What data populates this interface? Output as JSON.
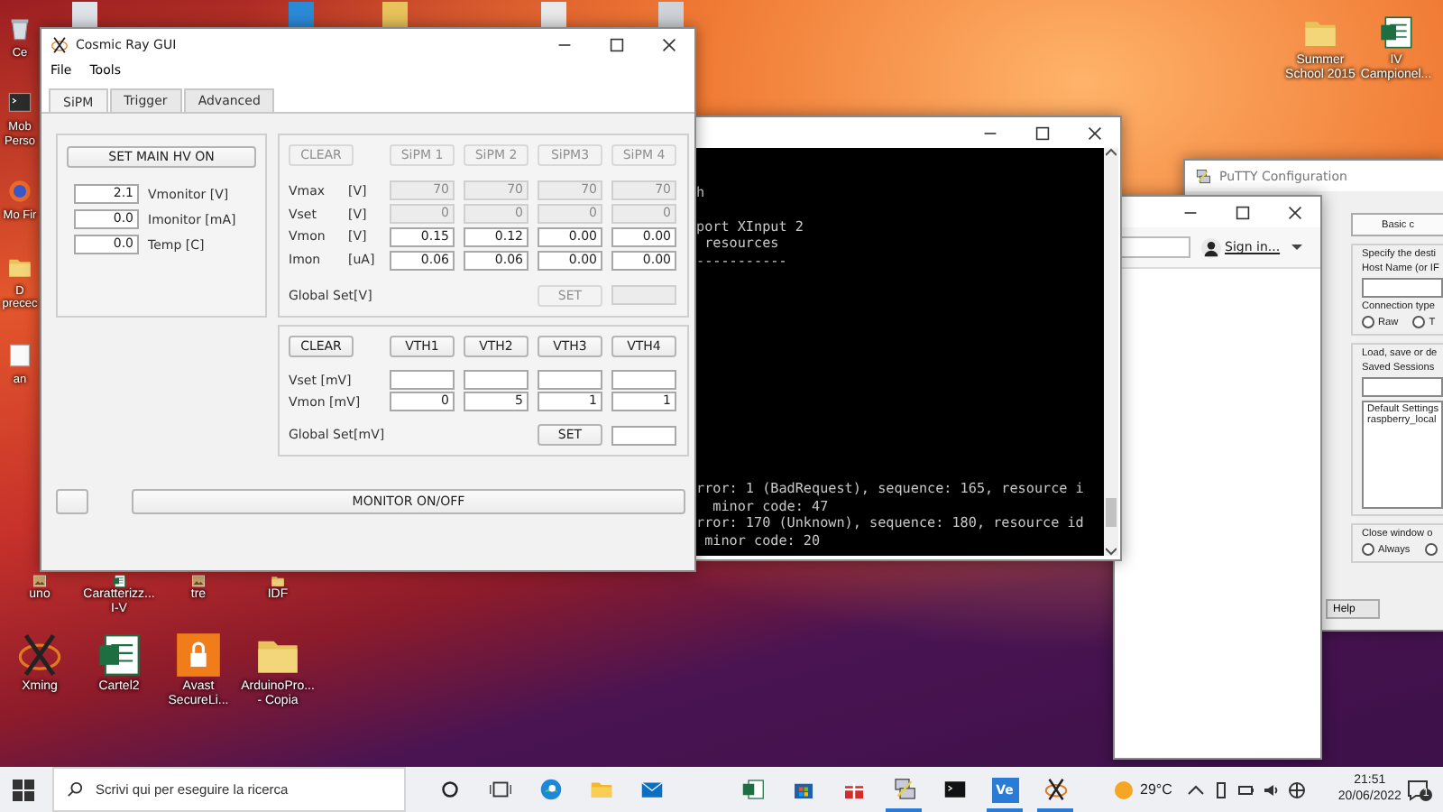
{
  "desktop": {
    "left_icons": [
      {
        "kind": "bin",
        "label": "Ce"
      },
      {
        "kind": "console",
        "label": "Mob Perso"
      },
      {
        "kind": "globe",
        "label": "Mo Fir"
      },
      {
        "kind": "folder",
        "label": "D precec"
      },
      {
        "kind": "file",
        "label": "an"
      }
    ],
    "bottom_rows": [
      [
        {
          "kind": "image",
          "label": "uno"
        },
        {
          "kind": "excel",
          "label": "Caratterizz... I-V"
        },
        {
          "kind": "image",
          "label": "tre"
        },
        {
          "kind": "folder",
          "label": "IDF"
        }
      ],
      [
        {
          "kind": "xming",
          "label": "Xming"
        },
        {
          "kind": "excel",
          "label": "Cartel2"
        },
        {
          "kind": "lock",
          "label": "Avast SecureLi..."
        },
        {
          "kind": "folder",
          "label": "ArduinoPro... - Copia"
        }
      ]
    ],
    "top_right_icons": [
      {
        "kind": "folder",
        "label": "Summer School 2015"
      },
      {
        "kind": "excel",
        "label": "IV Campionel..."
      }
    ]
  },
  "putty": {
    "title": "PuTTY Configuration",
    "header": "Basic c",
    "host_group": {
      "caption": "Specify the desti",
      "host_label": "Host Name (or IF",
      "conn_label": "Connection type",
      "radios": [
        {
          "label": "Raw",
          "selected": false
        },
        {
          "label": "T",
          "selected": false
        }
      ]
    },
    "session_group": {
      "caption": "Load, save or de",
      "saved_label": "Saved Sessions",
      "sessions": [
        "Default Settings",
        "raspberry_local"
      ]
    },
    "close_group": {
      "caption": "Close window o",
      "radios": [
        {
          "label": "Always",
          "selected": false
        },
        {
          "selected": false
        }
      ]
    },
    "help": "Help"
  },
  "browser": {
    "sign_in": "Sign in..."
  },
  "terminal": {
    "blocks": [
      [
        "h"
      ],
      [
        "port XInput 2",
        " resources",
        "-----------"
      ]
    ],
    "tail": [
      "rror: 1 (BadRequest), sequence: 165, resource i",
      "  minor code: 47",
      "rror: 170 (Unknown), sequence: 180, resource id",
      " minor code: 20"
    ]
  },
  "gui": {
    "title": "Cosmic Ray GUI",
    "menu": [
      "File",
      "Tools"
    ],
    "tabs": [
      {
        "label": "SiPM",
        "selected": true
      },
      {
        "label": "Trigger",
        "selected": false
      },
      {
        "label": "Advanced",
        "selected": false
      }
    ],
    "hv_button": "SET MAIN HV ON",
    "readouts": [
      {
        "value": "2.1",
        "label": "Vmonitor [V]"
      },
      {
        "value": "0.0",
        "label": "Imonitor [mA]"
      },
      {
        "value": "0.0",
        "label": "Temp [C]"
      }
    ],
    "sipm_panel": {
      "clear": {
        "label": "CLEAR",
        "disabled": true
      },
      "headers": [
        {
          "label": "SiPM 1",
          "disabled": true
        },
        {
          "label": "SiPM 2",
          "disabled": true
        },
        {
          "label": "SiPM3",
          "disabled": true
        },
        {
          "label": "SiPM 4",
          "disabled": true
        }
      ],
      "rows": [
        {
          "label": "Vmax",
          "unit": "[V]",
          "cells": [
            {
              "value": "70",
              "disabled": true
            },
            {
              "value": "70",
              "disabled": true
            },
            {
              "value": "70",
              "disabled": true
            },
            {
              "value": "70",
              "disabled": true
            }
          ]
        },
        {
          "label": "Vset",
          "unit": "[V]",
          "cells": [
            {
              "value": "0",
              "disabled": true
            },
            {
              "value": "0",
              "disabled": true
            },
            {
              "value": "0",
              "disabled": true
            },
            {
              "value": "0",
              "disabled": true
            }
          ]
        },
        {
          "label": "Vmon",
          "unit": "[V]",
          "cells": [
            {
              "value": "0.15",
              "disabled": false
            },
            {
              "value": "0.12",
              "disabled": false
            },
            {
              "value": "0.00",
              "disabled": false
            },
            {
              "value": "0.00",
              "disabled": false
            }
          ]
        },
        {
          "label": "Imon",
          "unit": "[uA]",
          "cells": [
            {
              "value": "0.06",
              "disabled": false
            },
            {
              "value": "0.06",
              "disabled": false
            },
            {
              "value": "0.00",
              "disabled": false
            },
            {
              "value": "0.00",
              "disabled": false
            }
          ]
        }
      ],
      "global": {
        "label": "Global Set[V]",
        "button": {
          "label": "SET",
          "disabled": true
        },
        "field": {
          "disabled": true
        }
      }
    },
    "vth_panel": {
      "clear": {
        "label": "CLEAR",
        "disabled": false
      },
      "headers": [
        {
          "label": "VTH1",
          "disabled": false
        },
        {
          "label": "VTH2",
          "disabled": false
        },
        {
          "label": "VTH3",
          "disabled": false
        },
        {
          "label": "VTH4",
          "disabled": false
        }
      ],
      "rows": [
        {
          "label": "Vset [mV]",
          "cells": [
            {
              "disabled": false
            },
            {
              "disabled": false
            },
            {
              "disabled": false
            },
            {
              "disabled": false
            }
          ]
        },
        {
          "label": "Vmon [mV]",
          "cells": [
            {
              "value": "0",
              "disabled": false
            },
            {
              "value": "5",
              "disabled": false
            },
            {
              "value": "1",
              "disabled": false
            },
            {
              "value": "1",
              "disabled": false
            }
          ]
        }
      ],
      "global": {
        "label": "Global Set[mV]",
        "button": {
          "label": "SET",
          "disabled": false
        },
        "field": {
          "disabled": false
        }
      }
    },
    "monitor_button": "MONITOR ON/OFF"
  },
  "taskbar": {
    "search_placeholder": "Scrivi qui per eseguire la ricerca",
    "apps": [
      {
        "kind": "cortana",
        "running": false
      },
      {
        "kind": "taskview",
        "running": false
      },
      {
        "kind": "edge",
        "running": false
      },
      {
        "kind": "explorer",
        "running": false
      },
      {
        "kind": "mail",
        "running": false
      },
      {
        "kind": "excel",
        "running": false
      },
      {
        "kind": "store",
        "running": false
      },
      {
        "kind": "gift",
        "running": false
      },
      {
        "kind": "putty",
        "running": true
      },
      {
        "kind": "console",
        "running": false
      },
      {
        "kind": "ve",
        "label": "Ve",
        "running": true
      },
      {
        "kind": "xming",
        "running": true
      }
    ],
    "weather": "29°C",
    "time": "21:51",
    "date": "20/06/2022",
    "notifications": "1"
  }
}
